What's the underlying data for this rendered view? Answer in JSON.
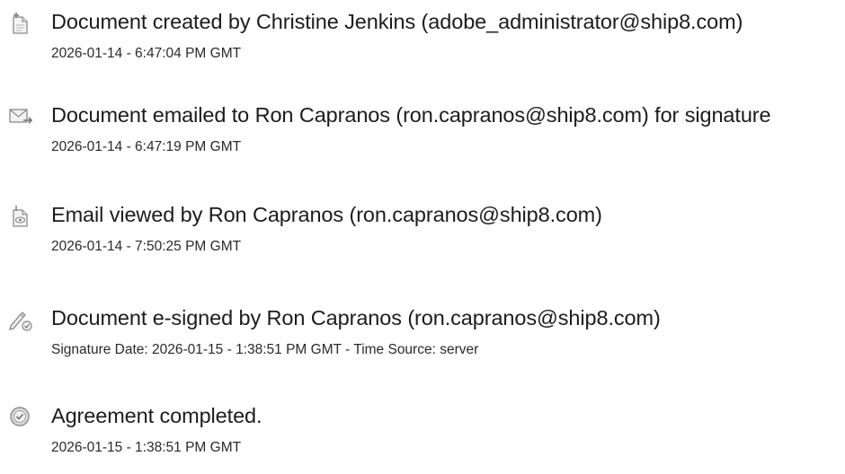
{
  "events": [
    {
      "icon": "document-created-icon",
      "title": "Document created by Christine Jenkins (adobe_administrator@ship8.com)",
      "meta": "2026-01-14 - 6:47:04 PM GMT"
    },
    {
      "icon": "email-sent-icon",
      "title": "Document emailed to Ron Capranos (ron.capranos@ship8.com) for signature",
      "meta": "2026-01-14 - 6:47:19 PM GMT"
    },
    {
      "icon": "email-viewed-icon",
      "title": "Email viewed by Ron Capranos (ron.capranos@ship8.com)",
      "meta": "2026-01-14 - 7:50:25 PM GMT"
    },
    {
      "icon": "e-signed-pen-icon",
      "title": "Document e-signed by Ron Capranos (ron.capranos@ship8.com)",
      "meta": "Signature Date: 2026-01-15 - 1:38:51 PM GMT - Time Source: server"
    },
    {
      "icon": "agreement-completed-icon",
      "title": "Agreement completed.",
      "meta": "2026-01-15 - 1:38:51 PM GMT"
    }
  ]
}
